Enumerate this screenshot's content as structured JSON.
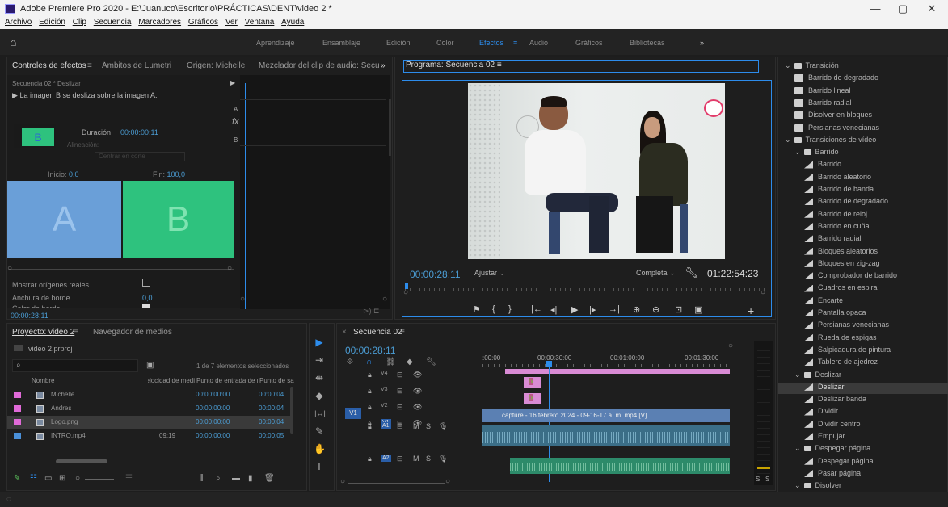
{
  "window": {
    "title": "Adobe Premiere Pro 2020 - E:\\Juanuco\\Escritorio\\PRÁCTICAS\\DENT\\video 2 *",
    "minimize": "—",
    "maximize": "▢",
    "close": "✕"
  },
  "menu": [
    "Archivo",
    "Edición",
    "Clip",
    "Secuencia",
    "Marcadores",
    "Gráficos",
    "Ver",
    "Ventana",
    "Ayuda"
  ],
  "workspaces": [
    "Aprendizaje",
    "Ensamblaje",
    "Edición",
    "Color",
    "Efectos",
    "Audio",
    "Gráficos",
    "Bibliotecas"
  ],
  "workspaces_more": "»",
  "home_icon": "⌂",
  "effect_controls": {
    "tabs": [
      "Controles de efectos",
      "Ámbitos de Lumetri",
      "Origen: Michelle",
      "Mezclador del clip de audio: Secu"
    ],
    "tab_menu": "≡",
    "more": "»",
    "sequence_label": "Secuencia 02 * Deslizar",
    "description": "La imagen B se desliza sobre la imagen A.",
    "thumb_label": "B",
    "duration_label": "Duración",
    "duration_value": "00:00:00:11",
    "alignment_label": "Alineación:",
    "alignment_value": "Centrar en corte",
    "start_label": "Inicio:",
    "start_value": "0,0",
    "end_label": "Fin:",
    "end_value": "100,0",
    "preview_a": "A",
    "preview_b": "B",
    "show_sources_label": "Mostrar orígenes reales",
    "border_width_label": "Anchura de borde",
    "border_width_value": "0,0",
    "border_color_label": "Color de borde",
    "timecode": "00:00:28:11",
    "fx_letter": "fx",
    "mini_a": "A",
    "mini_b": "B"
  },
  "program_monitor": {
    "title": "Programa: Secuencia 02",
    "menu": "≡",
    "timecode": "00:00:28:11",
    "fit": "Ajustar",
    "quality": "Completa",
    "duration": "01:22:54:23",
    "controls": [
      "⚑",
      "{",
      "}",
      "|←",
      "◂|",
      "▶",
      "|▸",
      "→|",
      "⊕",
      "⊖",
      "⊡",
      "▣",
      "+"
    ]
  },
  "project": {
    "tabs": [
      "Proyecto: video 2",
      "Navegador de medios"
    ],
    "tab_menu": "≡",
    "file": "video 2.prproj",
    "selection_info": "1 de 7 elementos seleccionados",
    "columns": [
      "Nombre",
      "Velocidad de medi",
      "Punto de entrada de m",
      "Punto de sa"
    ],
    "items": [
      {
        "name": "Michelle",
        "rate": "",
        "in": "00:00:00:00",
        "out": "00:00:04",
        "color": "#e06ad8"
      },
      {
        "name": "Andres",
        "rate": "",
        "in": "00:00:00:00",
        "out": "00:00:04",
        "color": "#e06ad8"
      },
      {
        "name": "Logo.png",
        "rate": "",
        "in": "00:00:00:00",
        "out": "00:00:04",
        "color": "#e06ad8"
      },
      {
        "name": "INTRO.mp4",
        "rate": "09:19",
        "in": "00:00:00:00",
        "out": "00:00:05",
        "color": "#4a90d9"
      }
    ]
  },
  "tools": [
    "▶",
    "⇥",
    "⇹",
    "◆",
    "|↔|",
    "✎",
    "✋",
    "T"
  ],
  "timeline": {
    "title": "Secuencia 02",
    "close": "×",
    "menu": "≡",
    "timecode": "00:00:28:11",
    "ruler": [
      ":00:00",
      "00:00:30:00",
      "00:01:00:00",
      "00:01:30:00"
    ],
    "tracks": [
      "V4",
      "V3",
      "V2",
      "V1",
      "A1",
      "A2"
    ],
    "src_v1": "V1",
    "clip_label": "capture - 16 febrero 2024 - 09-16-17 a. m..mp4 [V]",
    "fx": "fx",
    "track_m": "M",
    "track_s": "S",
    "meter_labels": [
      "S",
      "S"
    ]
  },
  "effects": {
    "items": [
      {
        "type": "folder",
        "level": 0,
        "label": "Transición"
      },
      {
        "type": "bin",
        "level": 1,
        "label": "Barrido de degradado"
      },
      {
        "type": "bin",
        "level": 1,
        "label": "Barrido lineal"
      },
      {
        "type": "bin",
        "level": 1,
        "label": "Barrido radial"
      },
      {
        "type": "bin",
        "level": 1,
        "label": "Disolver en bloques"
      },
      {
        "type": "bin",
        "level": 1,
        "label": "Persianas venecianas"
      },
      {
        "type": "folder",
        "level": 0,
        "label": "Transiciones de vídeo"
      },
      {
        "type": "folder",
        "level": 1,
        "label": "Barrido"
      },
      {
        "type": "fx",
        "level": 2,
        "label": "Barrido"
      },
      {
        "type": "fx",
        "level": 2,
        "label": "Barrido aleatorio"
      },
      {
        "type": "fx",
        "level": 2,
        "label": "Barrido de banda"
      },
      {
        "type": "fx",
        "level": 2,
        "label": "Barrido de degradado"
      },
      {
        "type": "fx",
        "level": 2,
        "label": "Barrido de reloj"
      },
      {
        "type": "fx",
        "level": 2,
        "label": "Barrido en cuña"
      },
      {
        "type": "fx",
        "level": 2,
        "label": "Barrido radial"
      },
      {
        "type": "fx",
        "level": 2,
        "label": "Bloques aleatorios"
      },
      {
        "type": "fx",
        "level": 2,
        "label": "Bloques en zig-zag"
      },
      {
        "type": "fx",
        "level": 2,
        "label": "Comprobador de barrido"
      },
      {
        "type": "fx",
        "level": 2,
        "label": "Cuadros en espiral"
      },
      {
        "type": "fx",
        "level": 2,
        "label": "Encarte"
      },
      {
        "type": "fx",
        "level": 2,
        "label": "Pantalla opaca"
      },
      {
        "type": "fx",
        "level": 2,
        "label": "Persianas venecianas"
      },
      {
        "type": "fx",
        "level": 2,
        "label": "Rueda de espigas"
      },
      {
        "type": "fx",
        "level": 2,
        "label": "Salpicadura de pintura"
      },
      {
        "type": "fx",
        "level": 2,
        "label": "Tablero de ajedrez"
      },
      {
        "type": "folder",
        "level": 1,
        "label": "Deslizar"
      },
      {
        "type": "fx",
        "level": 2,
        "label": "Deslizar",
        "selected": true
      },
      {
        "type": "fx",
        "level": 2,
        "label": "Deslizar banda"
      },
      {
        "type": "fx",
        "level": 2,
        "label": "Dividir"
      },
      {
        "type": "fx",
        "level": 2,
        "label": "Dividir centro"
      },
      {
        "type": "fx",
        "level": 2,
        "label": "Empujar"
      },
      {
        "type": "folder",
        "level": 1,
        "label": "Despegar página"
      },
      {
        "type": "fx",
        "level": 2,
        "label": "Despegar página"
      },
      {
        "type": "fx",
        "level": 2,
        "label": "Pasar página"
      },
      {
        "type": "folder",
        "level": 1,
        "label": "Disolver"
      }
    ]
  },
  "colors": {
    "accent": "#2d8ceb",
    "timecode": "#4b9cd3",
    "clip_v1": "#5b80b3",
    "clip_pink": "#d98bd4",
    "audio": "#3b6e87",
    "audio2": "#2d8b6a"
  }
}
